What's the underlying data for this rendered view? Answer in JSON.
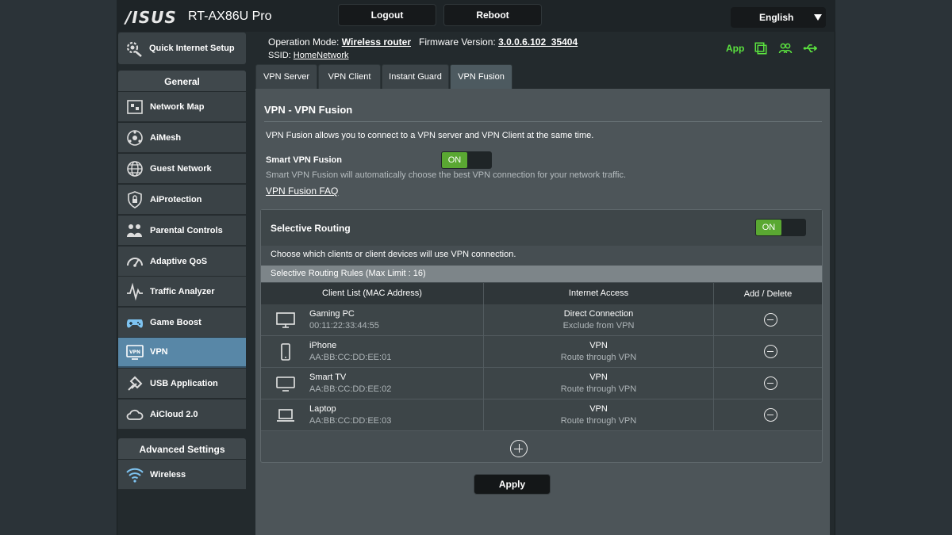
{
  "header": {
    "brand": "/ISUS",
    "model": "RT-AX86U Pro",
    "logout_label": "Logout",
    "reboot_label": "Reboot",
    "language": "English",
    "operation_mode_label": "Operation Mode:",
    "operation_mode_value": "Wireless router",
    "firmware_label": "Firmware Version:",
    "firmware_value": "3.0.0.6.102_35404",
    "ssid_label": "SSID:",
    "ssid_value": "HomeNetwork",
    "app_label": "App"
  },
  "sidebar": {
    "quick_setup": "Quick Internet Setup",
    "general_header": "General",
    "items": [
      {
        "label": "Network Map"
      },
      {
        "label": "AiMesh"
      },
      {
        "label": "Guest Network"
      },
      {
        "label": "AiProtection"
      },
      {
        "label": "Parental Controls"
      },
      {
        "label": "Adaptive QoS"
      },
      {
        "label": "Traffic Analyzer"
      },
      {
        "label": "Game Boost"
      },
      {
        "label": "VPN"
      },
      {
        "label": "USB Application"
      },
      {
        "label": "AiCloud 2.0"
      }
    ],
    "advanced_header": "Advanced Settings",
    "advanced_items": [
      {
        "label": "Wireless"
      }
    ]
  },
  "tabs": [
    {
      "label": "VPN Server"
    },
    {
      "label": "VPN Client"
    },
    {
      "label": "Instant Guard"
    },
    {
      "label": "VPN Fusion"
    }
  ],
  "main": {
    "title": "VPN - VPN Fusion",
    "description": "VPN Fusion allows you to connect to a VPN server and VPN Client at the same time.",
    "smart_label": "Smart VPN Fusion",
    "smart_toggle": "ON",
    "smart_desc": "Smart VPN Fusion will automatically choose the best VPN connection for your network traffic.",
    "faq_link": "VPN Fusion FAQ",
    "selective_routing_label": "Selective Routing",
    "selective_toggle": "ON",
    "selective_desc": "Choose which clients or client devices will use VPN connection.",
    "rules_bar": "Selective Routing Rules (Max Limit : 16)",
    "columns": [
      "Client List (MAC Address)",
      "Internet Access",
      "Add / Delete"
    ],
    "rows": [
      {
        "icon": "desktop-icon",
        "name": "Gaming PC",
        "mac": "00:11:22:33:44:55",
        "access": "Direct Connection",
        "access_desc": "Exclude from VPN"
      },
      {
        "icon": "phone-icon",
        "name": "iPhone",
        "mac": "AA:BB:CC:DD:EE:01",
        "access": "VPN",
        "access_desc": "Route through VPN"
      },
      {
        "icon": "tv-icon",
        "name": "Smart TV",
        "mac": "AA:BB:CC:DD:EE:02",
        "access": "VPN",
        "access_desc": "Route through VPN"
      },
      {
        "icon": "laptop-icon",
        "name": "Laptop",
        "mac": "AA:BB:CC:DD:EE:03",
        "access": "VPN",
        "access_desc": "Route through VPN"
      }
    ],
    "apply_label": "Apply"
  },
  "colors": {
    "accent_green": "#5aa832",
    "active_nav": "#5887a7",
    "app_green": "#5be33f"
  }
}
